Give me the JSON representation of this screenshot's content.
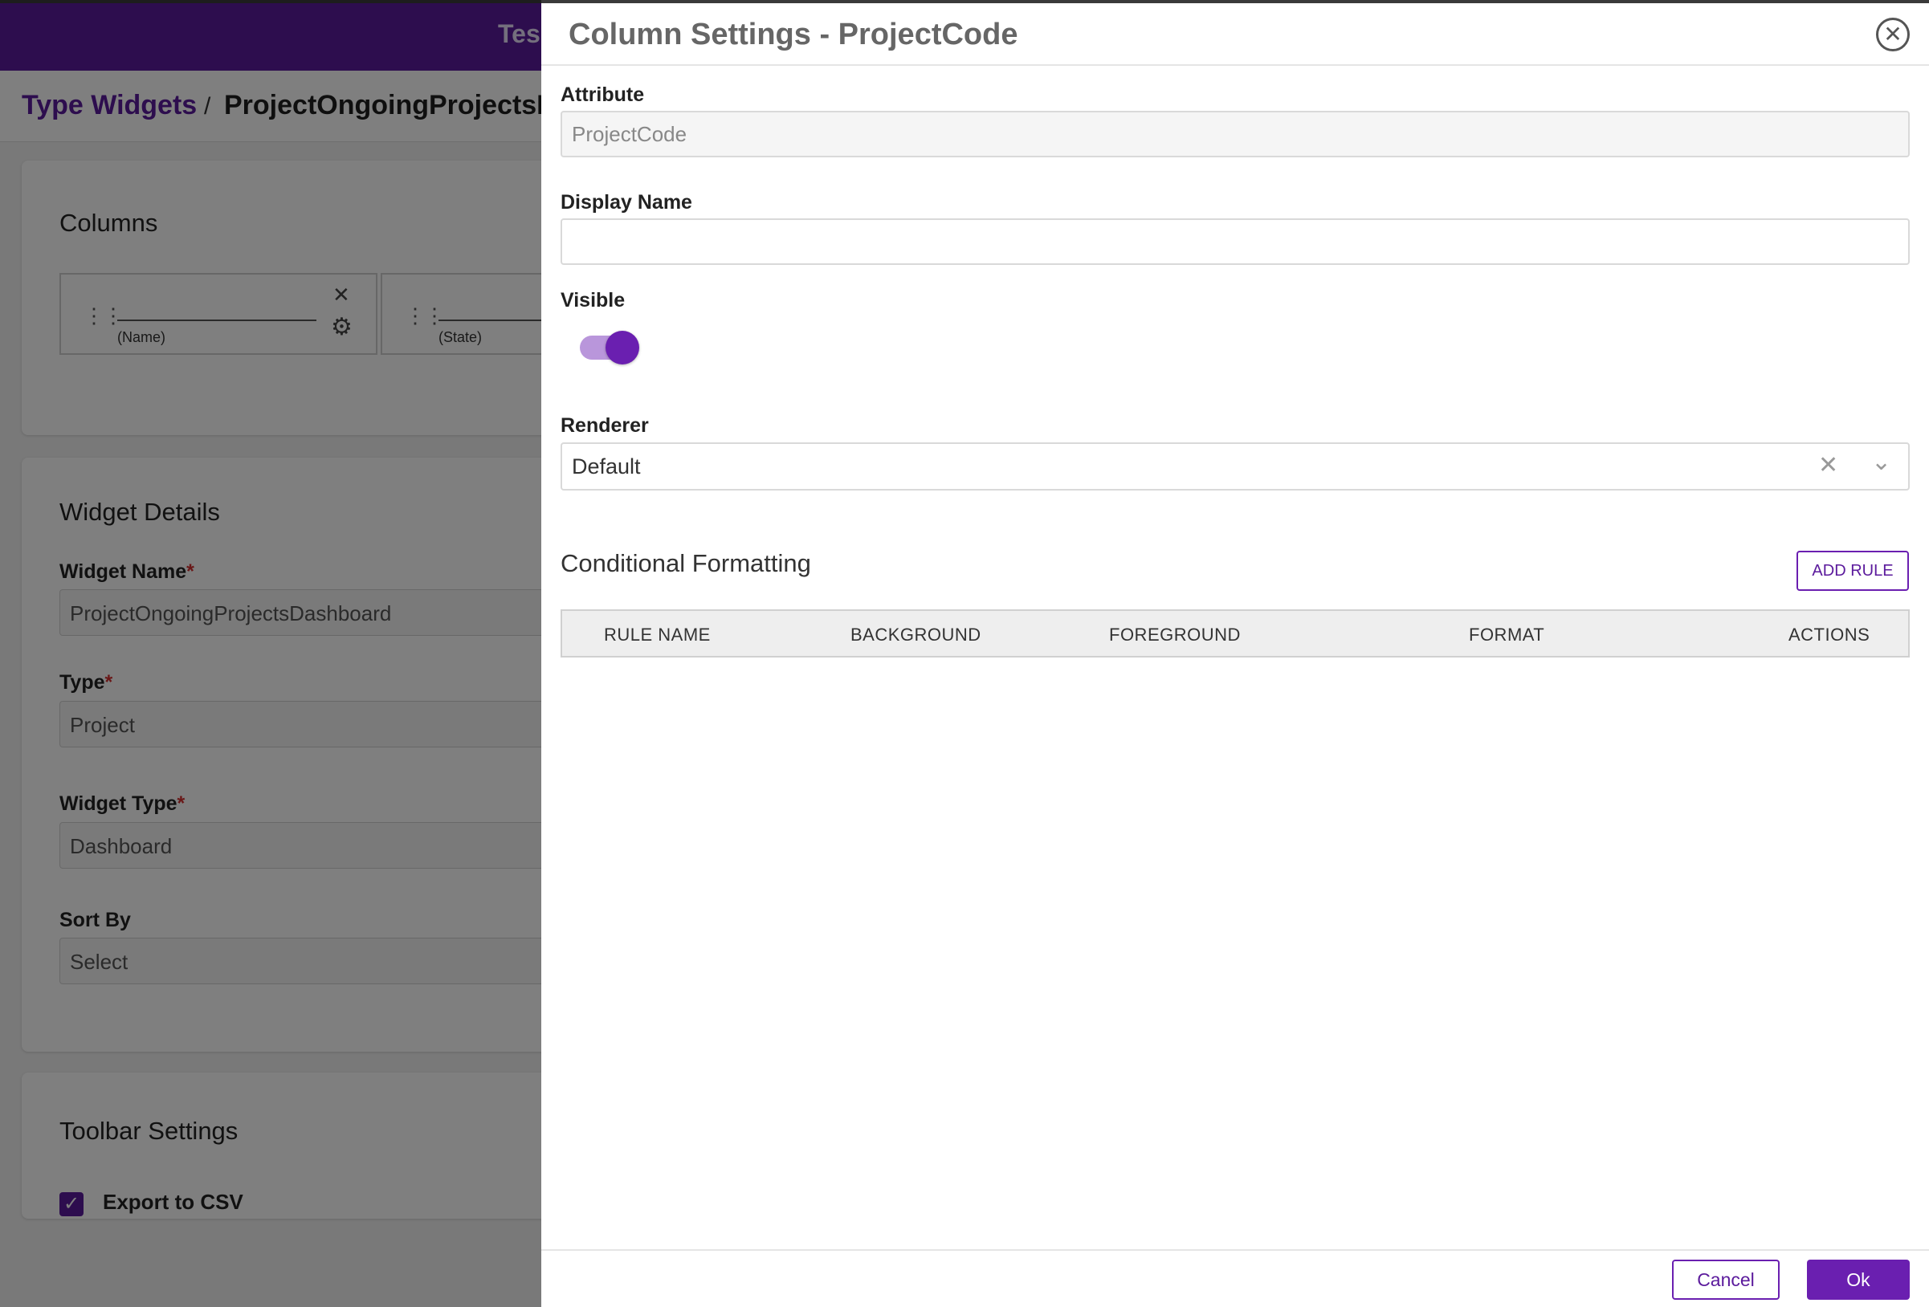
{
  "app": {
    "title_fragment": "Tes"
  },
  "breadcrumb": {
    "root": "Type Widgets",
    "separator": "/",
    "current": "ProjectOngoingProjectsDa"
  },
  "columns_section": {
    "title": "Columns",
    "items": [
      {
        "subtitle": "(Name)"
      },
      {
        "subtitle": "(State)"
      }
    ]
  },
  "widget_details": {
    "title": "Widget Details",
    "fields": {
      "widget_name": {
        "label": "Widget Name",
        "value": "ProjectOngoingProjectsDashboard"
      },
      "type": {
        "label": "Type",
        "value": "Project"
      },
      "widget_type": {
        "label": "Widget Type",
        "value": "Dashboard"
      },
      "sort_by": {
        "label": "Sort By",
        "placeholder": "Select"
      }
    },
    "required_mark": "*"
  },
  "toolbar_settings": {
    "title": "Toolbar Settings",
    "export_csv_label": "Export to CSV",
    "export_csv_checked": true
  },
  "drawer": {
    "title": "Column Settings - ProjectCode",
    "attribute": {
      "label": "Attribute",
      "value": "ProjectCode"
    },
    "display_name": {
      "label": "Display Name",
      "value": ""
    },
    "visible": {
      "label": "Visible",
      "on": true
    },
    "renderer": {
      "label": "Renderer",
      "value": "Default"
    },
    "conditional_formatting": {
      "title": "Conditional Formatting",
      "add_rule_label": "ADD RULE",
      "headers": [
        "RULE NAME",
        "BACKGROUND",
        "FOREGROUND",
        "FORMAT",
        "ACTIONS"
      ],
      "rows": []
    },
    "footer": {
      "cancel_label": "Cancel",
      "ok_label": "Ok"
    }
  },
  "icons": {
    "close": "close-icon",
    "drag": "drag-handle-icon",
    "remove": "x-icon",
    "settings": "gear-icon",
    "chevron": "chevron-down-icon",
    "check": "check-icon"
  },
  "colors": {
    "brand": "#5b1a9c",
    "accent": "#6a1fb0",
    "required": "#d32f2f"
  }
}
